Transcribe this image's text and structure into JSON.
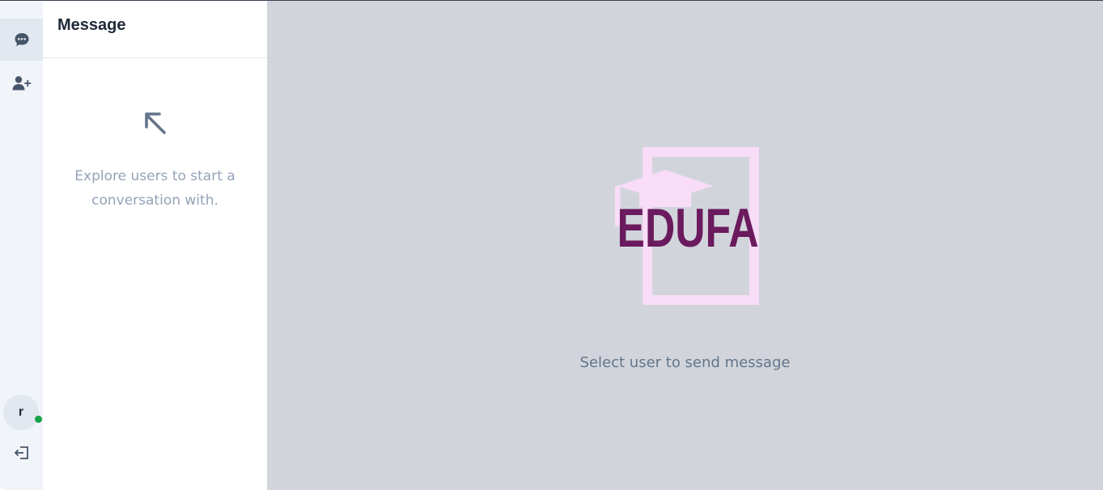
{
  "sidebar": {
    "items": [
      {
        "icon": "chat-bubble-icon",
        "active": true
      },
      {
        "icon": "user-plus-icon",
        "active": false
      }
    ],
    "user": {
      "initial": "r",
      "status": "online",
      "status_color": "#16a34a"
    },
    "logout": {
      "icon": "logout-icon"
    }
  },
  "panel": {
    "title": "Message",
    "empty_state": {
      "icon": "arrow-up-left-icon",
      "text": "Explore users to start a conversation with."
    }
  },
  "main": {
    "logo_text": "EDUFA",
    "prompt": "Select user to send message"
  },
  "colors": {
    "rail_bg": "#f1f5f9",
    "main_bg": "#d1d5db",
    "logo_primary": "#6b1a5e",
    "logo_accent": "#f8dcf8"
  }
}
